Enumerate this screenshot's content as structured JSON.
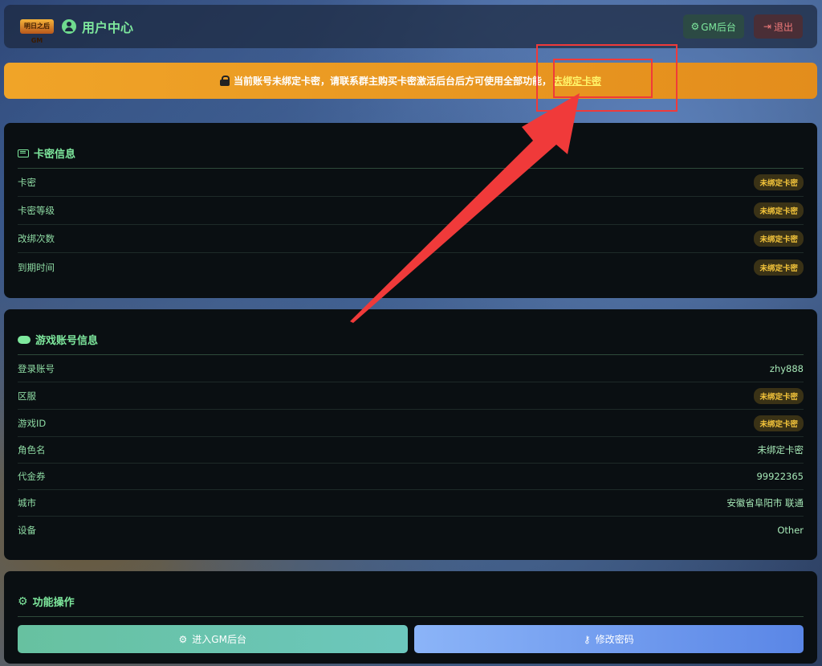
{
  "header": {
    "logo_text": "明日之后 GM",
    "title": "用户中心",
    "gm_button": "GM后台",
    "logout_button": "退出"
  },
  "warning": {
    "text": "当前账号未绑定卡密，请联系群主购买卡密激活后台后方可使用全部功能，",
    "link": "去绑定卡密"
  },
  "card_info": {
    "title": "卡密信息",
    "rows": [
      {
        "label": "卡密",
        "value": "未绑定卡密"
      },
      {
        "label": "卡密等级",
        "value": "未绑定卡密"
      },
      {
        "label": "改绑次数",
        "value": "未绑定卡密"
      },
      {
        "label": "到期时间",
        "value": "未绑定卡密"
      }
    ]
  },
  "game_info": {
    "title": "游戏账号信息",
    "rows": [
      {
        "label": "登录账号",
        "value": "zhy888"
      },
      {
        "label": "区服",
        "value": "未绑定卡密"
      },
      {
        "label": "游戏ID",
        "value": "未绑定卡密"
      },
      {
        "label": "角色名",
        "value": "未绑定卡密"
      },
      {
        "label": "代金券",
        "value": "99922365"
      },
      {
        "label": "城市",
        "value": "安徽省阜阳市 联通"
      },
      {
        "label": "设备",
        "value": "Other"
      }
    ]
  },
  "actions": {
    "title": "功能操作",
    "gm_button": "进入GM后台",
    "password_button": "修改密码"
  },
  "icons": {
    "user": "user-circle-icon",
    "gm": "gears-icon",
    "logout": "sign-out-icon",
    "lock": "lock-icon",
    "card": "id-card-icon",
    "game": "gamepad-icon",
    "settings": "gear-icon",
    "key": "key-icon"
  },
  "colors": {
    "accent_green": "#7ee89d",
    "warning_orange": "#f0a428",
    "badge_yellow": "#f2c33a",
    "annotation_red": "#f03a3a"
  }
}
